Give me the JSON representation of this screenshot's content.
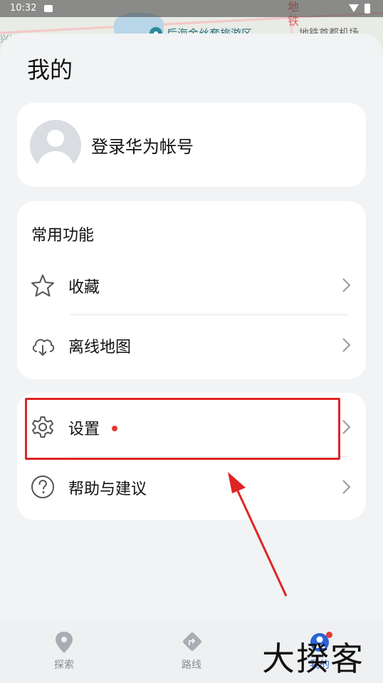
{
  "status_bar": {
    "time": "10:32"
  },
  "map": {
    "poi_label": "后海金丝套旅游区",
    "right_vertical_text": "地铁",
    "right_label": "地铁首都机场",
    "left_label": "兴城"
  },
  "page": {
    "title": "我的"
  },
  "user": {
    "login_label": "登录华为帐号"
  },
  "common": {
    "section_title": "常用功能",
    "items": [
      {
        "label": "收藏",
        "icon": "star-icon"
      },
      {
        "label": "离线地图",
        "icon": "cloud-download-icon"
      }
    ]
  },
  "more": {
    "items": [
      {
        "label": "设置",
        "icon": "gear-icon",
        "has_badge": true
      },
      {
        "label": "帮助与建议",
        "icon": "question-circle-icon"
      }
    ]
  },
  "bottom_nav": {
    "items": [
      {
        "label": "探索",
        "icon": "location-pin-icon"
      },
      {
        "label": "路线",
        "icon": "route-diamond-icon"
      },
      {
        "label": "我的",
        "icon": "profile-icon",
        "active": true,
        "has_badge": true
      }
    ]
  },
  "watermark": "大揆客",
  "colors": {
    "accent": "#2a63d8",
    "badge": "#e53935",
    "highlight": "#e02424"
  }
}
